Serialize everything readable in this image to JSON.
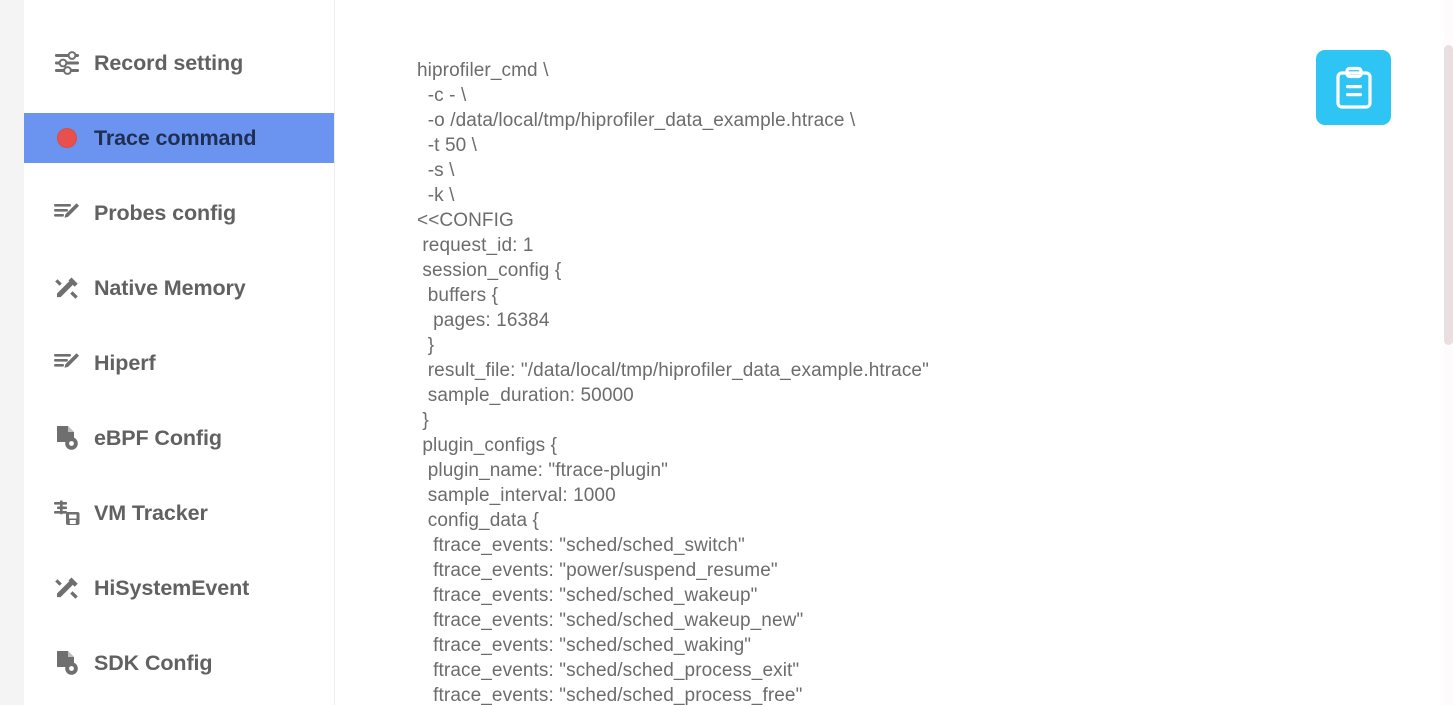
{
  "sidebar": {
    "items": [
      {
        "label": "Record setting",
        "icon": "sliders-icon",
        "active": false
      },
      {
        "label": "Trace command",
        "icon": "record-dot-icon",
        "active": true
      },
      {
        "label": "Probes config",
        "icon": "edit-lines-icon",
        "active": false
      },
      {
        "label": "Native Memory",
        "icon": "tools-icon",
        "active": false
      },
      {
        "label": "Hiperf",
        "icon": "edit-lines-icon",
        "active": false
      },
      {
        "label": "eBPF Config",
        "icon": "document-gear-icon",
        "active": false
      },
      {
        "label": "VM Tracker",
        "icon": "server-icon",
        "active": false
      },
      {
        "label": "HiSystemEvent",
        "icon": "tools-icon",
        "active": false
      },
      {
        "label": "SDK Config",
        "icon": "document-gear-icon",
        "active": false
      }
    ]
  },
  "main": {
    "copy_button": {
      "icon": "clipboard-icon",
      "label": ""
    },
    "command_text": "hiprofiler_cmd \\\n  -c - \\\n  -o /data/local/tmp/hiprofiler_data_example.htrace \\\n  -t 50 \\\n  -s \\\n  -k \\\n<<CONFIG\n request_id: 1\n session_config {\n  buffers {\n   pages: 16384\n  }\n  result_file: \"/data/local/tmp/hiprofiler_data_example.htrace\"\n  sample_duration: 50000\n }\n plugin_configs {\n  plugin_name: \"ftrace-plugin\"\n  sample_interval: 1000\n  config_data {\n   ftrace_events: \"sched/sched_switch\"\n   ftrace_events: \"power/suspend_resume\"\n   ftrace_events: \"sched/sched_wakeup\"\n   ftrace_events: \"sched/sched_wakeup_new\"\n   ftrace_events: \"sched/sched_waking\"\n   ftrace_events: \"sched/sched_process_exit\"\n   ftrace_events: \"sched/sched_process_free\""
  },
  "colors": {
    "accent_blue": "#6b93f0",
    "copy_button": "#2ec4f3",
    "record_red": "#e8504e",
    "code_text": "#6c6c6c",
    "active_text": "#1f2f52",
    "nav_text": "#616161"
  }
}
